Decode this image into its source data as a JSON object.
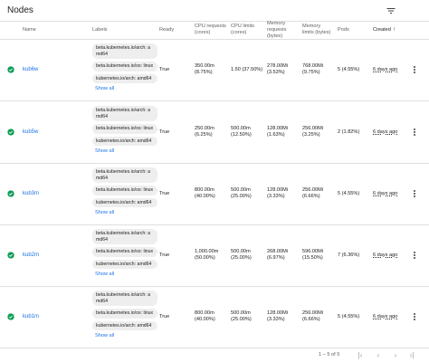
{
  "page": {
    "title": "Nodes",
    "filter_icon": "filter-list-icon"
  },
  "table": {
    "headers": {
      "name": "Name",
      "labels": "Labels",
      "ready": "Ready",
      "cpu_requests_1": "CPU requests",
      "cpu_requests_2": "(cores)",
      "cpu_limits_1": "CPU limits",
      "cpu_limits_2": "(cores)",
      "mem_requests_1": "Memory",
      "mem_requests_2": "requests",
      "mem_requests_3": "(bytes)",
      "mem_limits_1": "Memory",
      "mem_limits_2": "limits (bytes)",
      "pods": "Pods",
      "created": "Created",
      "sort_icon": "arrow-upward-icon"
    },
    "show_all_label": "Show all",
    "rows": [
      {
        "name": "kub6w",
        "labels": [
          "beta.kubernetes.io/arch: amd64",
          "beta.kubernetes.io/os: linux",
          "kubernetes.io/arch: amd64"
        ],
        "ready": "True",
        "cpu_req": "350.00m",
        "cpu_req_pct": "(8.75%)",
        "cpu_lim": "1.50 (37.50%)",
        "cpu_lim_pct": "",
        "mem_req": "278.00Mi",
        "mem_req_pct": "(3.53%)",
        "mem_lim": "768.00Mi",
        "mem_lim_pct": "(9.75%)",
        "pods": "5 (4.55%)",
        "created": "6 days ago"
      },
      {
        "name": "kub5w",
        "labels": [
          "beta.kubernetes.io/arch: amd64",
          "beta.kubernetes.io/os: linux",
          "kubernetes.io/arch: amd64"
        ],
        "ready": "True",
        "cpu_req": "250.00m",
        "cpu_req_pct": "(6.25%)",
        "cpu_lim": "500.00m",
        "cpu_lim_pct": "(12.50%)",
        "mem_req": "128.00Mi",
        "mem_req_pct": "(1.63%)",
        "mem_lim": "256.00Mi",
        "mem_lim_pct": "(3.25%)",
        "pods": "2 (1.82%)",
        "created": "6 days ago"
      },
      {
        "name": "kub3m",
        "labels": [
          "beta.kubernetes.io/arch: amd64",
          "beta.kubernetes.io/os: linux",
          "kubernetes.io/arch: amd64"
        ],
        "ready": "True",
        "cpu_req": "800.00m",
        "cpu_req_pct": "(40.00%)",
        "cpu_lim": "500.00m",
        "cpu_lim_pct": "(25.00%)",
        "mem_req": "128.00Mi",
        "mem_req_pct": "(3.33%)",
        "mem_lim": "256.00Mi",
        "mem_lim_pct": "(6.66%)",
        "pods": "5 (4.55%)",
        "created": "6 days ago"
      },
      {
        "name": "kub2m",
        "labels": [
          "beta.kubernetes.io/arch: amd64",
          "beta.kubernetes.io/os: linux",
          "kubernetes.io/arch: amd64"
        ],
        "ready": "True",
        "cpu_req": "1,000.00m",
        "cpu_req_pct": "(50.00%)",
        "cpu_lim": "500.00m",
        "cpu_lim_pct": "(25.00%)",
        "mem_req": "268.00Mi",
        "mem_req_pct": "(6.97%)",
        "mem_lim": "596.00Mi",
        "mem_lim_pct": "(15.50%)",
        "pods": "7 (6.36%)",
        "created": "6 days ago"
      },
      {
        "name": "kub1m",
        "labels": [
          "beta.kubernetes.io/arch: amd64",
          "beta.kubernetes.io/os: linux",
          "kubernetes.io/arch: amd64"
        ],
        "ready": "True",
        "cpu_req": "800.00m",
        "cpu_req_pct": "(40.00%)",
        "cpu_lim": "500.00m",
        "cpu_lim_pct": "(25.00%)",
        "mem_req": "128.00Mi",
        "mem_req_pct": "(3.33%)",
        "mem_lim": "256.00Mi",
        "mem_lim_pct": "(6.66%)",
        "pods": "5 (4.55%)",
        "created": "6 days ago"
      }
    ]
  },
  "pagination": {
    "range": "1 – 5 of 5",
    "first_icon": "first-page-icon",
    "prev_icon": "chevron-left-icon",
    "next_icon": "chevron-right-icon",
    "last_icon": "last-page-icon"
  },
  "colors": {
    "link": "#1a73e8",
    "ready_green": "#0f9d58",
    "chip_bg": "#eeeeee",
    "divider": "#e0e0e0"
  }
}
